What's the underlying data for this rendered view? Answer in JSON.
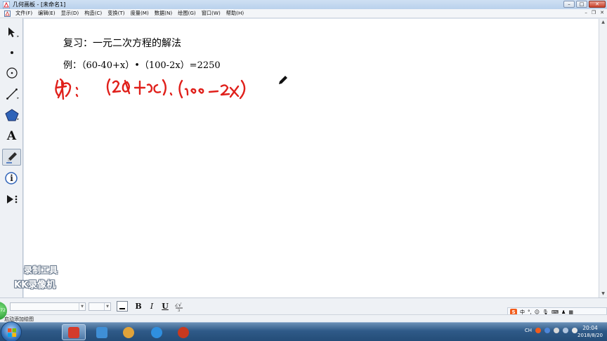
{
  "window": {
    "title": "几何画板 - [未命名1]",
    "controls": {
      "minimize": "–",
      "maximize": "□",
      "close": "✕"
    }
  },
  "menubar": {
    "items": [
      {
        "label": "文件(F)"
      },
      {
        "label": "编辑(E)"
      },
      {
        "label": "显示(D)"
      },
      {
        "label": "构造(C)"
      },
      {
        "label": "变换(T)"
      },
      {
        "label": "度量(M)"
      },
      {
        "label": "数据(N)"
      },
      {
        "label": "绘图(G)"
      },
      {
        "label": "窗口(W)"
      },
      {
        "label": "帮助(H)"
      }
    ],
    "doc_controls": {
      "minimize": "–",
      "restore": "❐",
      "close": "✕"
    }
  },
  "toolbox": {
    "tools": [
      {
        "name": "arrow-tool",
        "icon": "arrow-icon"
      },
      {
        "name": "point-tool",
        "icon": "point-icon"
      },
      {
        "name": "compass-tool",
        "icon": "circle-icon"
      },
      {
        "name": "straightedge-tool",
        "icon": "segment-icon"
      },
      {
        "name": "polygon-tool",
        "icon": "polygon-icon"
      },
      {
        "name": "text-tool",
        "icon": "text-icon",
        "glyph": "A"
      },
      {
        "name": "marker-tool",
        "icon": "pen-icon",
        "active": true
      },
      {
        "name": "information-tool",
        "icon": "info-icon",
        "glyph": "i"
      },
      {
        "name": "custom-tool",
        "icon": "custom-tools-icon"
      }
    ]
  },
  "canvas": {
    "heading": "复习：一元二次方程的解法",
    "example": "例：（60-40+x）•（100-2x）=2250",
    "ink_color": "#e0201b"
  },
  "watermark": {
    "line1": "录制工具",
    "line2": "KK录像机"
  },
  "formatbar": {
    "bold": "B",
    "italic": "I",
    "underline": "U",
    "special_symbols_icon": "math-symbols-icon"
  },
  "ime": {
    "logo": "S",
    "lang": "中"
  },
  "statusbar": {
    "text": "启动添加绘图",
    "badge": "72"
  },
  "taskbar": {
    "apps": [
      {
        "name": "windows-explorer-folder",
        "color": "#d33b2c"
      },
      {
        "name": "notepad-app",
        "color": "#3f8fd6"
      },
      {
        "name": "media-app",
        "color": "#e0a33a"
      },
      {
        "name": "ie-browser",
        "color": "#2f8fdf"
      },
      {
        "name": "recorder-app",
        "color": "#c8391f"
      }
    ],
    "tray_lang": "CH",
    "clock_time": "20:04",
    "clock_date": "2018/8/20"
  }
}
